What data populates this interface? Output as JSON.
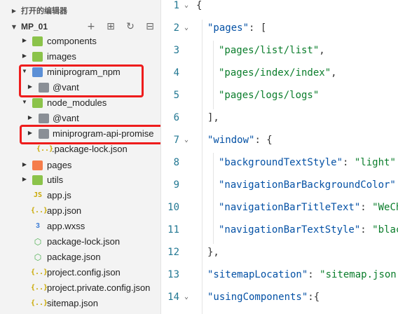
{
  "explorer": {
    "open_editors_label": "打开的编辑器",
    "project_name": "MP_01",
    "actions": {
      "new_file_icon": "plus-icon",
      "new_folder_icon": "new-folder-icon",
      "refresh_icon": "refresh-icon",
      "collapse_icon": "collapse-all-icon",
      "new_file_glyph": "+",
      "new_folder_glyph": "⊞",
      "refresh_glyph": "↻",
      "collapse_glyph": "⊟"
    },
    "tree": [
      {
        "label": "components",
        "kind": "folder",
        "color": "#8bc34a",
        "expanded": false,
        "depth": 0
      },
      {
        "label": "images",
        "kind": "folder",
        "color": "#8bc34a",
        "expanded": false,
        "depth": 0
      },
      {
        "label": "miniprogram_npm",
        "kind": "folder",
        "color": "#5b8fd6",
        "expanded": true,
        "depth": 0
      },
      {
        "label": "@vant",
        "kind": "folder",
        "color": "#8a8f96",
        "expanded": false,
        "depth": 1
      },
      {
        "label": "node_modules",
        "kind": "folder",
        "color": "#8bc34a",
        "expanded": true,
        "depth": 0
      },
      {
        "label": "@vant",
        "kind": "folder",
        "color": "#8a8f96",
        "expanded": false,
        "depth": 1
      },
      {
        "label": "miniprogram-api-promise",
        "kind": "folder",
        "color": "#8a8f96",
        "expanded": false,
        "depth": 1
      },
      {
        "label": ".package-lock.json",
        "kind": "json",
        "depth": 1
      },
      {
        "label": "pages",
        "kind": "folder",
        "color": "#f57c4a",
        "expanded": false,
        "depth": 0
      },
      {
        "label": "utils",
        "kind": "folder",
        "color": "#8bc34a",
        "expanded": false,
        "depth": 0
      },
      {
        "label": "app.js",
        "kind": "js",
        "depth": 0
      },
      {
        "label": "app.json",
        "kind": "json",
        "depth": 0
      },
      {
        "label": "app.wxss",
        "kind": "css",
        "depth": 0
      },
      {
        "label": "package-lock.json",
        "kind": "hex",
        "depth": 0
      },
      {
        "label": "package.json",
        "kind": "hex",
        "depth": 0
      },
      {
        "label": "project.config.json",
        "kind": "json",
        "depth": 0
      },
      {
        "label": "project.private.config.json",
        "kind": "json",
        "depth": 0
      },
      {
        "label": "sitemap.json",
        "kind": "json",
        "depth": 0
      }
    ],
    "icon_glyphs": {
      "js": "JS",
      "json": "{..}",
      "css": "3",
      "hex": "⬡"
    },
    "highlight_color": "#ee1c1c"
  },
  "editor": {
    "lines": [
      {
        "n": "1",
        "fold": "⌄",
        "text": "{"
      },
      {
        "n": "2",
        "fold": "⌄",
        "key": "\"pages\"",
        "rest": ": ["
      },
      {
        "n": "3",
        "str": "\"pages/list/list\"",
        "rest": ","
      },
      {
        "n": "4",
        "str": "\"pages/index/index\"",
        "rest": ","
      },
      {
        "n": "5",
        "str": "\"pages/logs/logs\""
      },
      {
        "n": "6",
        "text": "],"
      },
      {
        "n": "7",
        "fold": "⌄",
        "key": "\"window\"",
        "rest": ": {"
      },
      {
        "n": "8",
        "key": "\"backgroundTextStyle\"",
        "rest": ": ",
        "str": "\"light\""
      },
      {
        "n": "9",
        "key": "\"navigationBarBackgroundColor\""
      },
      {
        "n": "10",
        "key": "\"navigationBarTitleText\"",
        "rest": ": ",
        "str": "\"WeChat\""
      },
      {
        "n": "11",
        "key": "\"navigationBarTextStyle\"",
        "rest": ": ",
        "str": "\"black\""
      },
      {
        "n": "12",
        "text": "},"
      },
      {
        "n": "13",
        "key": "\"sitemapLocation\"",
        "rest": ": ",
        "str": "\"sitemap.json\""
      },
      {
        "n": "14",
        "fold": "⌄",
        "key": "\"usingComponents\"",
        "rest": ":{"
      }
    ]
  }
}
